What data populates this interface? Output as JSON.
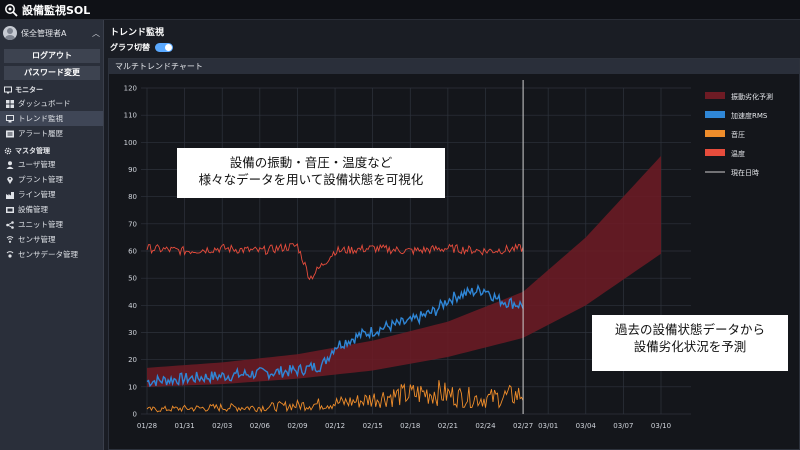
{
  "app": {
    "title": "設備監視SOL"
  },
  "sidebar": {
    "user": "保全管理者A",
    "logout": "ログアウト",
    "change_password": "パスワード変更",
    "monitor_section": "モニター",
    "monitor_items": [
      {
        "label": "ダッシュボード",
        "icon": "dashboard-icon"
      },
      {
        "label": "トレンド監視",
        "icon": "monitor-icon",
        "active": true
      },
      {
        "label": "アラート履歴",
        "icon": "alert-list-icon"
      }
    ],
    "master_section": "マスタ管理",
    "master_items": [
      {
        "label": "ユーザ管理",
        "icon": "user-icon"
      },
      {
        "label": "プラント管理",
        "icon": "location-icon"
      },
      {
        "label": "ライン管理",
        "icon": "factory-icon"
      },
      {
        "label": "設備管理",
        "icon": "equipment-icon"
      },
      {
        "label": "ユニット管理",
        "icon": "share-icon"
      },
      {
        "label": "センサ管理",
        "icon": "sensor-icon"
      },
      {
        "label": "センサデータ管理",
        "icon": "sensor-data-icon"
      }
    ]
  },
  "main": {
    "title": "トレンド監視",
    "toggle_label": "グラフ切替",
    "toggle_on": true,
    "panel_title": "マルチトレンドチャート"
  },
  "callouts": {
    "left_line1": "設備の振動・音圧・温度など",
    "left_line2": "様々なデータを用いて設備状態を可視化",
    "right_line1": "過去の設備状態データから",
    "right_line2": "設備劣化状況を予測"
  },
  "chart_data": {
    "type": "line",
    "x": [
      "01/28",
      "01/31",
      "02/03",
      "02/06",
      "02/09",
      "02/12",
      "02/15",
      "02/18",
      "02/21",
      "02/24",
      "02/27",
      "03/01",
      "03/04",
      "03/07",
      "03/10"
    ],
    "ylim": [
      0,
      120
    ],
    "yticks": [
      0,
      10,
      20,
      30,
      40,
      50,
      60,
      70,
      80,
      90,
      100,
      110,
      120
    ],
    "current_date": "02/27",
    "legend_position": "right",
    "grid": true,
    "series": [
      {
        "name": "振動劣化予測",
        "color": "#6e1b24",
        "kind": "band",
        "x": [
          "01/28",
          "02/03",
          "02/09",
          "02/15",
          "02/21",
          "02/27",
          "03/04",
          "03/10"
        ],
        "lower": [
          10,
          11,
          13,
          16,
          21,
          28,
          40,
          59
        ],
        "upper": [
          17,
          19,
          22,
          27,
          34,
          45,
          65,
          95
        ]
      },
      {
        "name": "加速度RMS",
        "color": "#2f86d6",
        "kind": "line",
        "x": [
          "01/28",
          "01/31",
          "02/03",
          "02/06",
          "02/09",
          "02/11",
          "02/12",
          "02/14",
          "02/16",
          "02/18",
          "02/20",
          "02/21",
          "02/22",
          "02/24",
          "02/25",
          "02/27"
        ],
        "values": [
          12,
          13,
          14,
          15,
          16,
          18,
          25,
          29,
          32,
          34,
          38,
          42,
          44,
          46,
          42,
          40
        ]
      },
      {
        "name": "音圧",
        "color": "#ef8d2b",
        "kind": "line",
        "x": [
          "01/28",
          "02/03",
          "02/06",
          "02/09",
          "02/12",
          "02/14",
          "02/16",
          "02/18",
          "02/20",
          "02/22",
          "02/24",
          "02/27"
        ],
        "values": [
          2,
          3,
          3,
          4,
          5,
          6,
          8,
          9,
          10,
          8,
          7,
          9
        ]
      },
      {
        "name": "温度",
        "color": "#e74c3c",
        "kind": "line",
        "x": [
          "01/28",
          "01/31",
          "02/03",
          "02/06",
          "02/09",
          "02/10",
          "02/12",
          "02/15",
          "02/18",
          "02/21",
          "02/24",
          "02/27"
        ],
        "values": [
          61,
          60,
          61,
          60,
          62,
          50,
          60,
          61,
          60,
          61,
          60,
          61
        ]
      },
      {
        "name": "現在日時",
        "color": "#cfcfcf",
        "kind": "vline"
      }
    ]
  }
}
